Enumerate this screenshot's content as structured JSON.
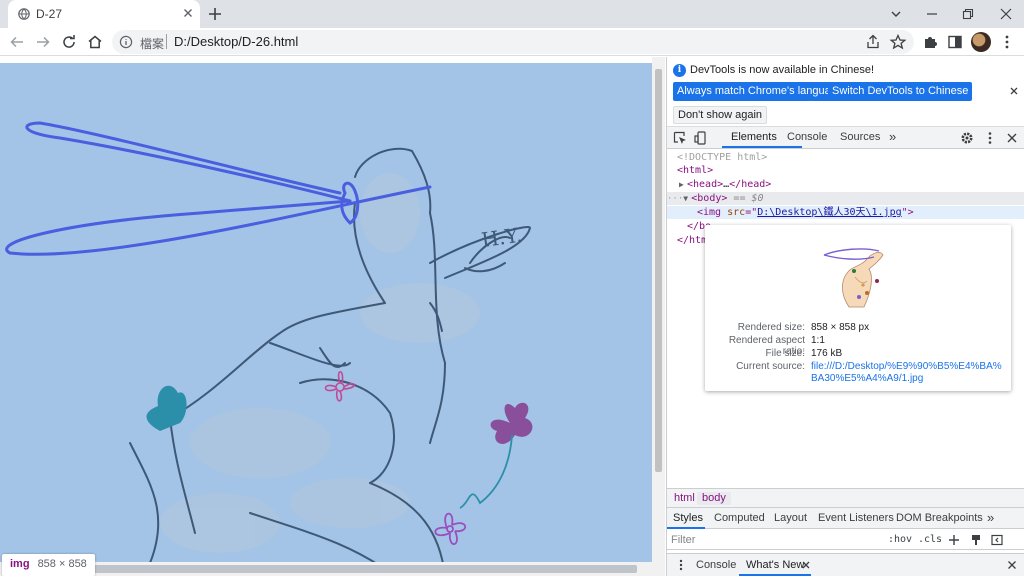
{
  "browser": {
    "tab_title": "D-27",
    "address_kind": "檔案",
    "address_url": "D:/Desktop/D-26.html"
  },
  "page": {
    "hover_chip": {
      "tag": "img",
      "dims": "858 × 858"
    },
    "signature": "H.Y."
  },
  "devtools": {
    "infobar": {
      "message": "DevTools is now available in Chinese!",
      "btn_match": "Always match Chrome's language",
      "btn_switch": "Switch DevTools to Chinese",
      "btn_dont_show": "Don't show again"
    },
    "tabs": {
      "elements": "Elements",
      "console": "Console",
      "sources": "Sources",
      "more": "»"
    },
    "dom": {
      "doctype": "<!DOCTYPE html>",
      "html_open": "<html>",
      "head_open": "<head>",
      "head_ellipsis": "…",
      "head_close": "</head>",
      "body_open": "<body>",
      "body_marker": "== $0",
      "img_open": "<img",
      "src_attr": "src",
      "src_value": "D:\\Desktop\\鐵人30天\\1.jpg",
      "img_close": ">",
      "body_close_partial": "</bo",
      "html_close_partial": "</htm"
    },
    "tooltip": {
      "rendered_size_label": "Rendered size:",
      "rendered_size_value": "858 × 858 px",
      "aspect_label": "Rendered aspect ratio:",
      "aspect_value": "1:1",
      "filesize_label": "File size:",
      "filesize_value": "176 kB",
      "source_label": "Current source:",
      "source_value": "file:///D:/Desktop/%E9%90%B5%E4%BA%BA30%E5%A4%A9/1.jpg"
    },
    "breadcrumbs": [
      "html",
      "body"
    ],
    "style_tabs": [
      "Styles",
      "Computed",
      "Layout",
      "Event Listeners",
      "DOM Breakpoints",
      "»"
    ],
    "filter_placeholder": "Filter",
    "hov_label": ":hov",
    "cls_label": ".cls",
    "drawer": {
      "console": "Console",
      "whats_new": "What's New"
    }
  }
}
